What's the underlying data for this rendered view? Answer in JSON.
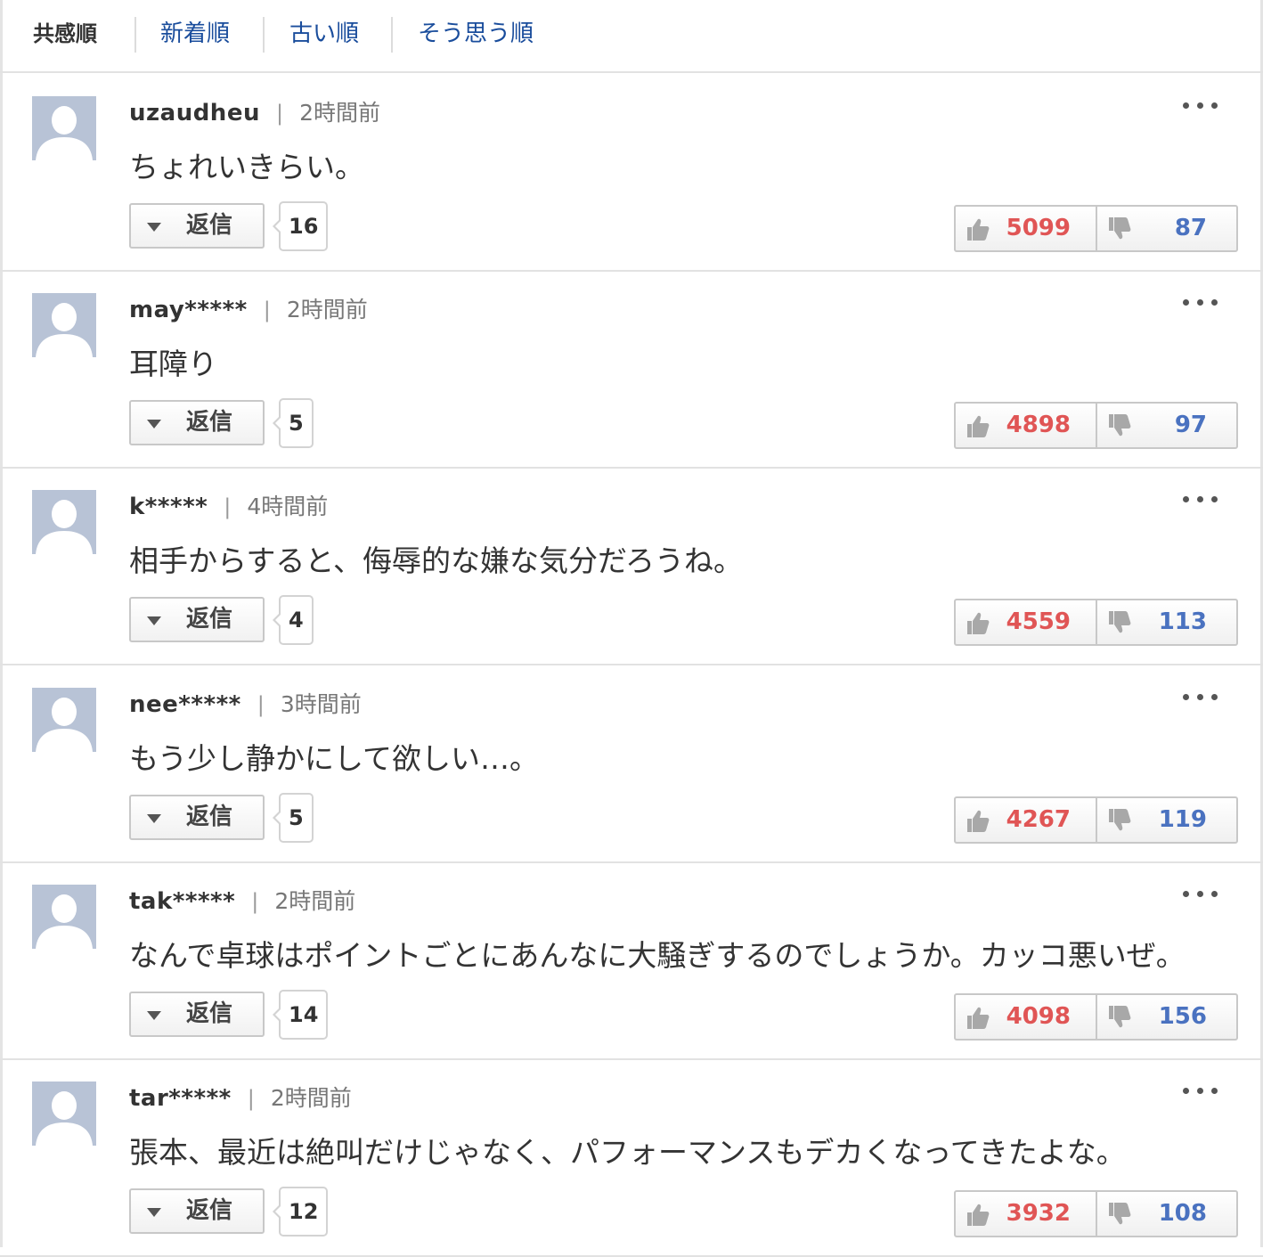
{
  "sort": {
    "tabs": [
      {
        "label": "共感順",
        "active": true
      },
      {
        "label": "新着順",
        "active": false
      },
      {
        "label": "古い順",
        "active": false
      },
      {
        "label": "そう思う順",
        "active": false
      }
    ]
  },
  "ui": {
    "reply_label": "返信",
    "separator": "|",
    "avatar_icon": "default-user-avatar",
    "more_icon": "more-horizontal-icon",
    "like_icon": "thumbs-up-icon",
    "dislike_icon": "thumbs-down-icon",
    "colors": {
      "like": "#e05555",
      "dislike": "#4a72c0",
      "link": "#1a4d9c",
      "avatar": "#b8c3d6"
    }
  },
  "comments": [
    {
      "user": "uzaudheu",
      "time": "2時間前",
      "text": "ちょれいきらい。",
      "replies": "16",
      "likes": "5099",
      "dislikes": "87"
    },
    {
      "user": "may*****",
      "time": "2時間前",
      "text": "耳障り",
      "replies": "5",
      "likes": "4898",
      "dislikes": "97"
    },
    {
      "user": "k*****",
      "time": "4時間前",
      "text": "相手からすると、侮辱的な嫌な気分だろうね。",
      "replies": "4",
      "likes": "4559",
      "dislikes": "113"
    },
    {
      "user": "nee*****",
      "time": "3時間前",
      "text": "もう少し静かにして欲しい…。",
      "replies": "5",
      "likes": "4267",
      "dislikes": "119"
    },
    {
      "user": "tak*****",
      "time": "2時間前",
      "text": "なんで卓球はポイントごとにあんなに大騒ぎするのでしょうか。カッコ悪いぜ。",
      "replies": "14",
      "likes": "4098",
      "dislikes": "156"
    },
    {
      "user": "tar*****",
      "time": "2時間前",
      "text": "張本、最近は絶叫だけじゃなく、パフォーマンスもデカくなってきたよな。",
      "replies": "12",
      "likes": "3932",
      "dislikes": "108"
    }
  ]
}
